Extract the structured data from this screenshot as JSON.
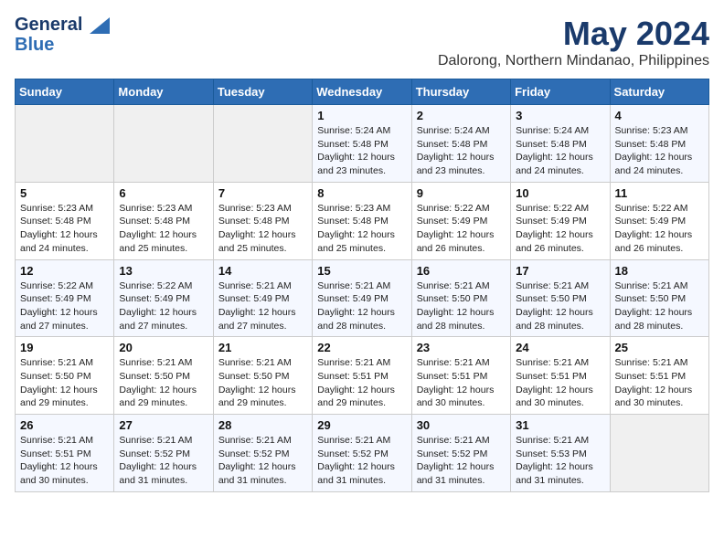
{
  "header": {
    "logo_line1": "General",
    "logo_line2": "Blue",
    "month_title": "May 2024",
    "location": "Dalorong, Northern Mindanao, Philippines"
  },
  "calendar": {
    "weekdays": [
      "Sunday",
      "Monday",
      "Tuesday",
      "Wednesday",
      "Thursday",
      "Friday",
      "Saturday"
    ],
    "weeks": [
      [
        {
          "day": "",
          "info": ""
        },
        {
          "day": "",
          "info": ""
        },
        {
          "day": "",
          "info": ""
        },
        {
          "day": "1",
          "info": "Sunrise: 5:24 AM\nSunset: 5:48 PM\nDaylight: 12 hours\nand 23 minutes."
        },
        {
          "day": "2",
          "info": "Sunrise: 5:24 AM\nSunset: 5:48 PM\nDaylight: 12 hours\nand 23 minutes."
        },
        {
          "day": "3",
          "info": "Sunrise: 5:24 AM\nSunset: 5:48 PM\nDaylight: 12 hours\nand 24 minutes."
        },
        {
          "day": "4",
          "info": "Sunrise: 5:23 AM\nSunset: 5:48 PM\nDaylight: 12 hours\nand 24 minutes."
        }
      ],
      [
        {
          "day": "5",
          "info": "Sunrise: 5:23 AM\nSunset: 5:48 PM\nDaylight: 12 hours\nand 24 minutes."
        },
        {
          "day": "6",
          "info": "Sunrise: 5:23 AM\nSunset: 5:48 PM\nDaylight: 12 hours\nand 25 minutes."
        },
        {
          "day": "7",
          "info": "Sunrise: 5:23 AM\nSunset: 5:48 PM\nDaylight: 12 hours\nand 25 minutes."
        },
        {
          "day": "8",
          "info": "Sunrise: 5:23 AM\nSunset: 5:48 PM\nDaylight: 12 hours\nand 25 minutes."
        },
        {
          "day": "9",
          "info": "Sunrise: 5:22 AM\nSunset: 5:49 PM\nDaylight: 12 hours\nand 26 minutes."
        },
        {
          "day": "10",
          "info": "Sunrise: 5:22 AM\nSunset: 5:49 PM\nDaylight: 12 hours\nand 26 minutes."
        },
        {
          "day": "11",
          "info": "Sunrise: 5:22 AM\nSunset: 5:49 PM\nDaylight: 12 hours\nand 26 minutes."
        }
      ],
      [
        {
          "day": "12",
          "info": "Sunrise: 5:22 AM\nSunset: 5:49 PM\nDaylight: 12 hours\nand 27 minutes."
        },
        {
          "day": "13",
          "info": "Sunrise: 5:22 AM\nSunset: 5:49 PM\nDaylight: 12 hours\nand 27 minutes."
        },
        {
          "day": "14",
          "info": "Sunrise: 5:21 AM\nSunset: 5:49 PM\nDaylight: 12 hours\nand 27 minutes."
        },
        {
          "day": "15",
          "info": "Sunrise: 5:21 AM\nSunset: 5:49 PM\nDaylight: 12 hours\nand 28 minutes."
        },
        {
          "day": "16",
          "info": "Sunrise: 5:21 AM\nSunset: 5:50 PM\nDaylight: 12 hours\nand 28 minutes."
        },
        {
          "day": "17",
          "info": "Sunrise: 5:21 AM\nSunset: 5:50 PM\nDaylight: 12 hours\nand 28 minutes."
        },
        {
          "day": "18",
          "info": "Sunrise: 5:21 AM\nSunset: 5:50 PM\nDaylight: 12 hours\nand 28 minutes."
        }
      ],
      [
        {
          "day": "19",
          "info": "Sunrise: 5:21 AM\nSunset: 5:50 PM\nDaylight: 12 hours\nand 29 minutes."
        },
        {
          "day": "20",
          "info": "Sunrise: 5:21 AM\nSunset: 5:50 PM\nDaylight: 12 hours\nand 29 minutes."
        },
        {
          "day": "21",
          "info": "Sunrise: 5:21 AM\nSunset: 5:50 PM\nDaylight: 12 hours\nand 29 minutes."
        },
        {
          "day": "22",
          "info": "Sunrise: 5:21 AM\nSunset: 5:51 PM\nDaylight: 12 hours\nand 29 minutes."
        },
        {
          "day": "23",
          "info": "Sunrise: 5:21 AM\nSunset: 5:51 PM\nDaylight: 12 hours\nand 30 minutes."
        },
        {
          "day": "24",
          "info": "Sunrise: 5:21 AM\nSunset: 5:51 PM\nDaylight: 12 hours\nand 30 minutes."
        },
        {
          "day": "25",
          "info": "Sunrise: 5:21 AM\nSunset: 5:51 PM\nDaylight: 12 hours\nand 30 minutes."
        }
      ],
      [
        {
          "day": "26",
          "info": "Sunrise: 5:21 AM\nSunset: 5:51 PM\nDaylight: 12 hours\nand 30 minutes."
        },
        {
          "day": "27",
          "info": "Sunrise: 5:21 AM\nSunset: 5:52 PM\nDaylight: 12 hours\nand 31 minutes."
        },
        {
          "day": "28",
          "info": "Sunrise: 5:21 AM\nSunset: 5:52 PM\nDaylight: 12 hours\nand 31 minutes."
        },
        {
          "day": "29",
          "info": "Sunrise: 5:21 AM\nSunset: 5:52 PM\nDaylight: 12 hours\nand 31 minutes."
        },
        {
          "day": "30",
          "info": "Sunrise: 5:21 AM\nSunset: 5:52 PM\nDaylight: 12 hours\nand 31 minutes."
        },
        {
          "day": "31",
          "info": "Sunrise: 5:21 AM\nSunset: 5:53 PM\nDaylight: 12 hours\nand 31 minutes."
        },
        {
          "day": "",
          "info": ""
        }
      ]
    ]
  }
}
